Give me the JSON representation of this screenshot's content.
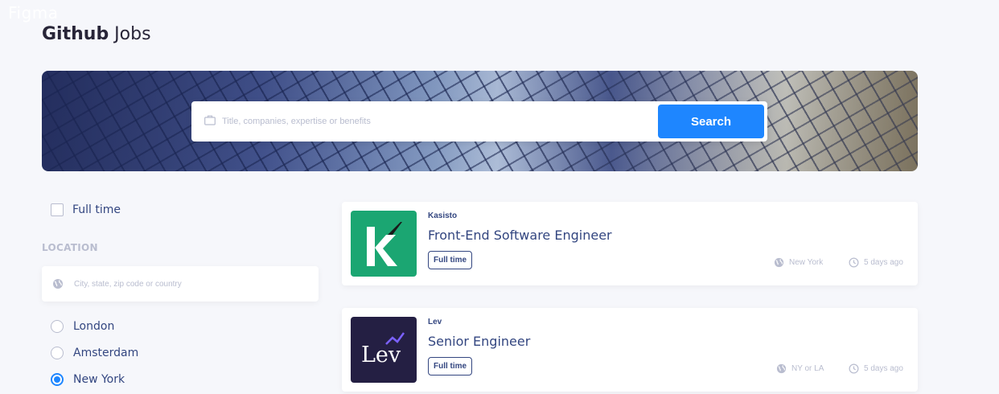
{
  "watermark": "Figma",
  "brand": {
    "bold": "Github",
    "light": " Jobs"
  },
  "search": {
    "placeholder": "Title, companies, expertise or benefits",
    "button_label": "Search"
  },
  "filters": {
    "full_time_label": "Full time",
    "full_time_checked": false,
    "location_heading": "LOCATION",
    "location_placeholder": "City, state, zip code or country",
    "locations": [
      {
        "label": "London",
        "checked": false
      },
      {
        "label": "Amsterdam",
        "checked": false
      },
      {
        "label": "New York",
        "checked": true
      }
    ]
  },
  "jobs": [
    {
      "company": "Kasisto",
      "title": "Front-End Software Engineer",
      "type": "Full time",
      "location": "New York",
      "posted": "5 days ago",
      "logo_text": "K",
      "logo_bg": "#1BA672"
    },
    {
      "company": "Lev",
      "title": "Senior Engineer",
      "type": "Full time",
      "location": "NY or LA",
      "posted": "5 days ago",
      "logo_text": "Lev",
      "logo_bg": "#241F43"
    }
  ],
  "colors": {
    "accent": "#1E86FF",
    "text": "#334680",
    "muted": "#B9BDCF",
    "background": "#F6F7FB"
  }
}
